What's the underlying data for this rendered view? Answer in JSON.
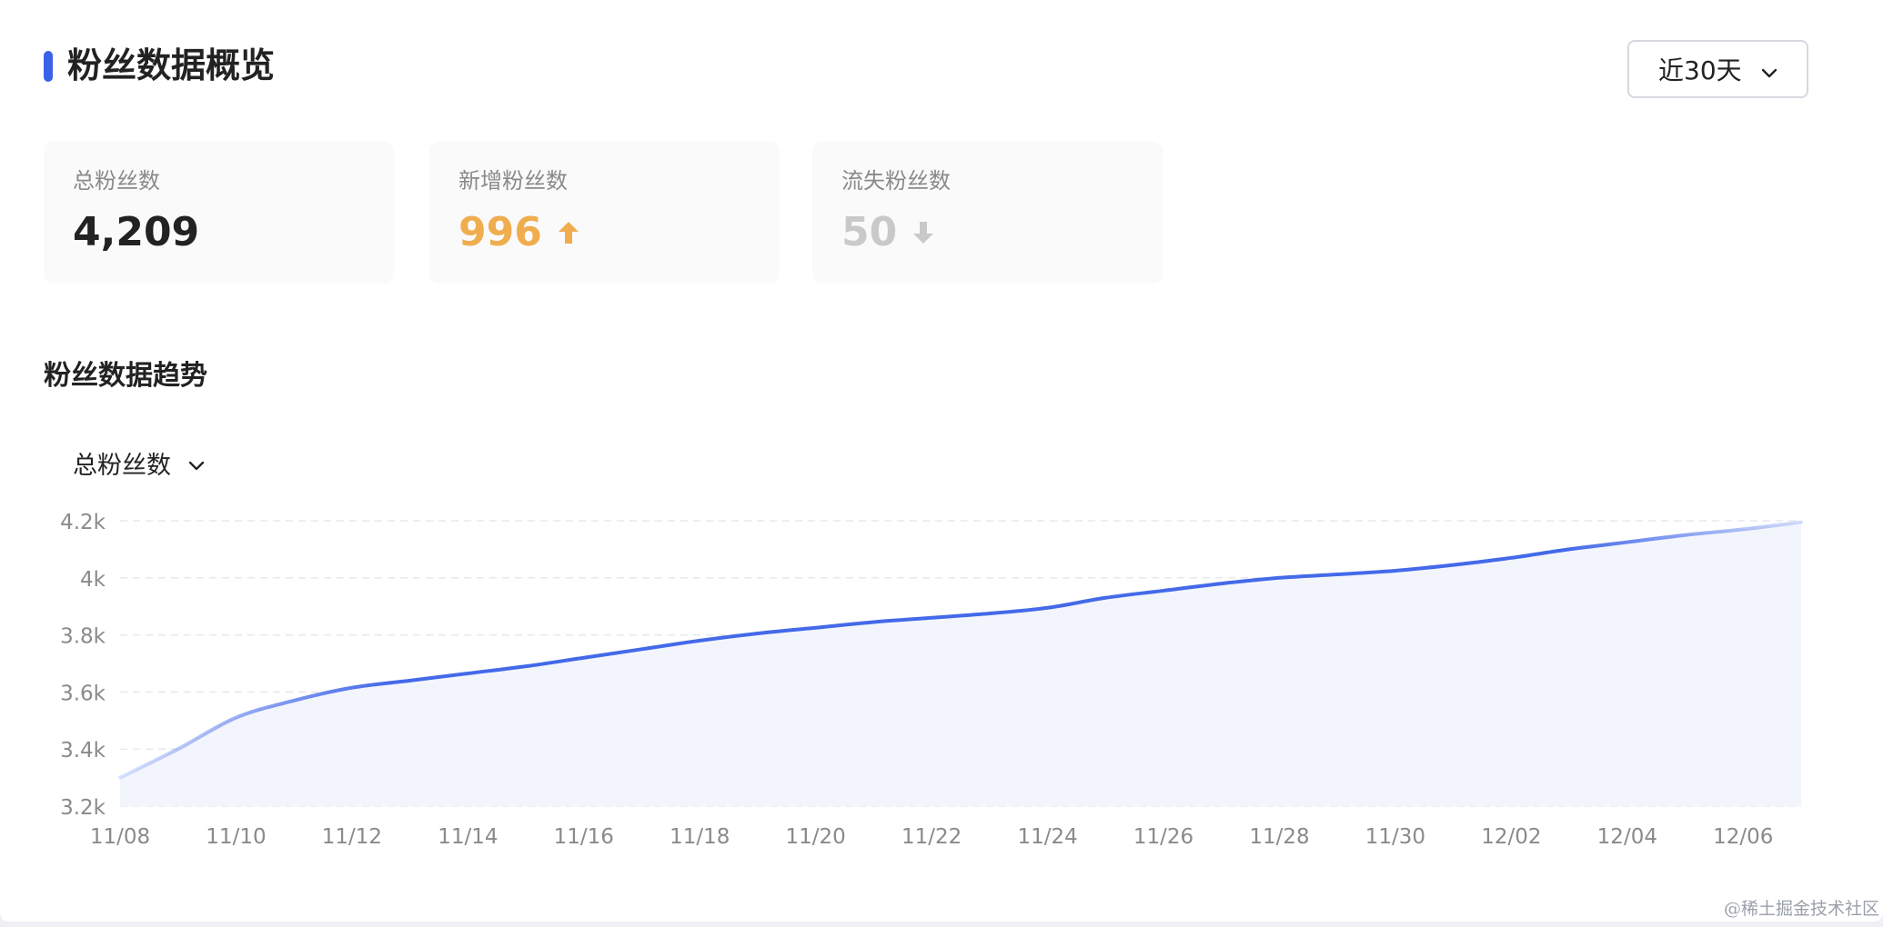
{
  "header": {
    "title": "粉丝数据概览",
    "range_select": {
      "value": "近30天"
    }
  },
  "stats": [
    {
      "label": "总粉丝数",
      "value": "4,209",
      "color": "#222222",
      "trend": "none"
    },
    {
      "label": "新增粉丝数",
      "value": "996",
      "color": "#f0ad4e",
      "trend": "up"
    },
    {
      "label": "流失粉丝数",
      "value": "50",
      "color": "#c9c9c9",
      "trend": "down"
    }
  ],
  "trend": {
    "title": "粉丝数据趋势",
    "metric_select": {
      "value": "总粉丝数"
    }
  },
  "colors": {
    "accent": "#3a62e8",
    "up": "#f0ad4e",
    "down": "#c9c9c9"
  },
  "watermark": "@稀土掘金技术社区",
  "chart_data": {
    "type": "area",
    "ytick_labels": [
      "3.2k",
      "3.4k",
      "3.6k",
      "3.8k",
      "4k",
      "4.2k"
    ],
    "yticks": [
      3200,
      3400,
      3600,
      3800,
      4000,
      4200
    ],
    "ylim": [
      3200,
      4200
    ],
    "xtick_labels": [
      "11/08",
      "11/10",
      "11/12",
      "11/14",
      "11/16",
      "11/18",
      "11/20",
      "11/22",
      "11/24",
      "11/26",
      "11/28",
      "11/30",
      "12/02",
      "12/04",
      "12/06"
    ],
    "x": [
      "11/08",
      "11/09",
      "11/10",
      "11/11",
      "11/12",
      "11/13",
      "11/14",
      "11/15",
      "11/16",
      "11/17",
      "11/18",
      "11/19",
      "11/20",
      "11/21",
      "11/22",
      "11/23",
      "11/24",
      "11/25",
      "11/26",
      "11/27",
      "11/28",
      "11/29",
      "11/30",
      "12/01",
      "12/02",
      "12/03",
      "12/04",
      "12/05",
      "12/06",
      "12/07"
    ],
    "series": [
      {
        "values": [
          3300,
          3400,
          3510,
          3570,
          3615,
          3640,
          3665,
          3690,
          3720,
          3750,
          3780,
          3805,
          3825,
          3845,
          3860,
          3875,
          3895,
          3930,
          3955,
          3980,
          4000,
          4012,
          4025,
          4045,
          4070,
          4100,
          4125,
          4150,
          4170,
          4195
        ]
      }
    ],
    "grid": true
  }
}
